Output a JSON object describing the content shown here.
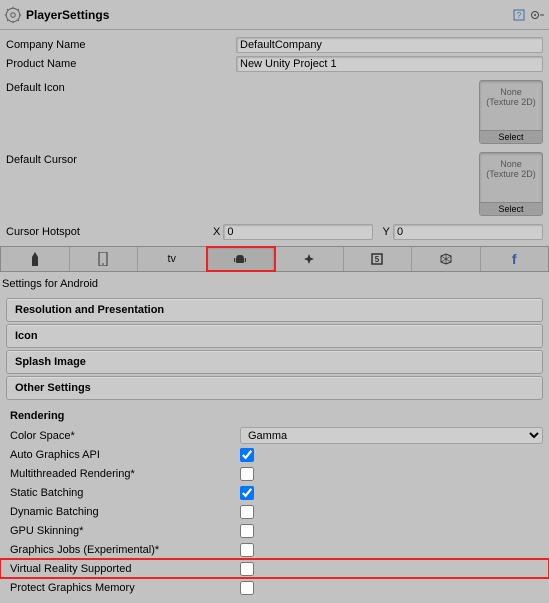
{
  "header": {
    "title": "PlayerSettings"
  },
  "fields": {
    "company_label": "Company Name",
    "company_value": "DefaultCompany",
    "product_label": "Product Name",
    "product_value": "New Unity Project 1",
    "default_icon_label": "Default Icon",
    "default_cursor_label": "Default Cursor",
    "texture_none": "None",
    "texture_type": "(Texture 2D)",
    "select_label": "Select",
    "cursor_hotspot_label": "Cursor Hotspot",
    "hotspot_x_label": "X",
    "hotspot_x_value": "0",
    "hotspot_y_label": "Y",
    "hotspot_y_value": "0"
  },
  "settings_for": "Settings for Android",
  "sections": {
    "resolution": "Resolution and Presentation",
    "icon": "Icon",
    "splash": "Splash Image",
    "other": "Other Settings"
  },
  "rendering": {
    "heading": "Rendering",
    "color_space_label": "Color Space*",
    "color_space_value": "Gamma",
    "auto_graphics_label": "Auto Graphics API",
    "auto_graphics_checked": true,
    "multithreaded_label": "Multithreaded Rendering*",
    "multithreaded_checked": false,
    "static_batch_label": "Static Batching",
    "static_batch_checked": true,
    "dynamic_batch_label": "Dynamic Batching",
    "dynamic_batch_checked": false,
    "gpu_skin_label": "GPU Skinning*",
    "gpu_skin_checked": false,
    "graphics_jobs_label": "Graphics Jobs (Experimental)*",
    "graphics_jobs_checked": false,
    "vr_label": "Virtual Reality Supported",
    "vr_checked": false,
    "protect_mem_label": "Protect Graphics Memory",
    "protect_mem_checked": false
  }
}
